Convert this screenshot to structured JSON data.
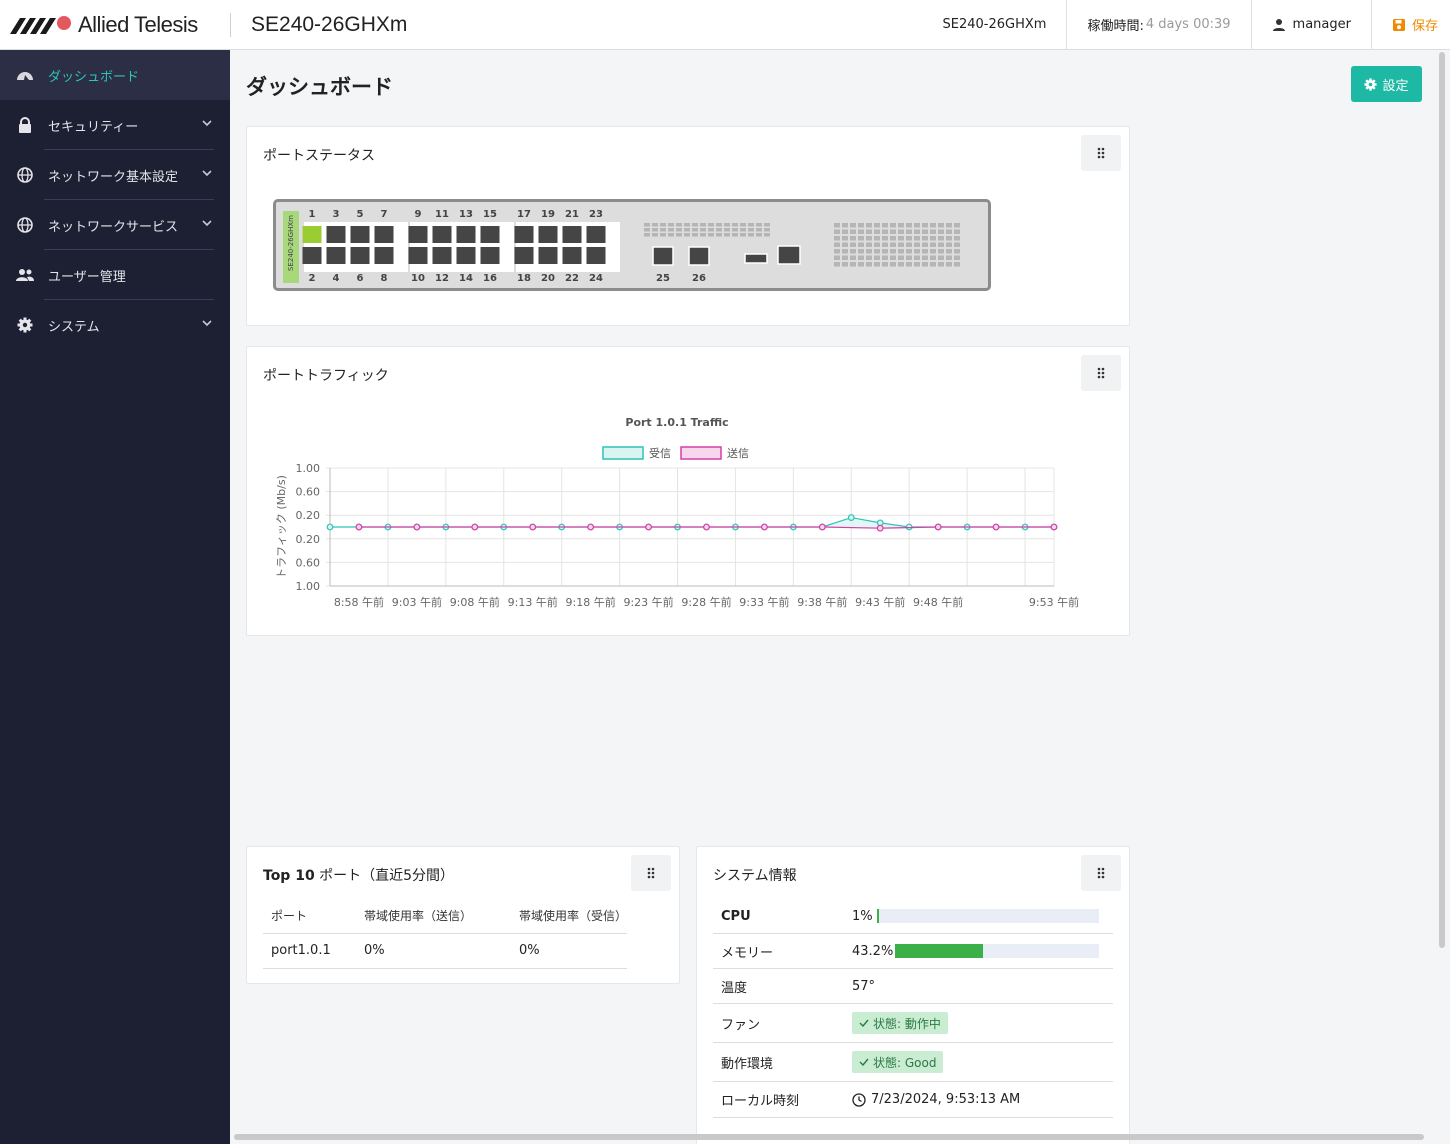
{
  "header": {
    "brand": "Allied Telesis",
    "device_title": "SE240-26GHXm",
    "hostname": "SE240-26GHXm",
    "uptime_label": "稼働時間:",
    "uptime_value": "4 days 00:39",
    "user": "manager",
    "save_label": "保存",
    "icons": [
      "allied-telesis-logo",
      "user-icon",
      "save-icon"
    ],
    "colors": {
      "save": "#f08a00"
    }
  },
  "sidebar": {
    "items": [
      {
        "label": "ダッシュボード",
        "icon": "dashboard-icon",
        "active": true
      },
      {
        "label": "セキュリティー",
        "icon": "lock-icon",
        "expandable": true
      },
      {
        "label": "ネットワーク基本設定",
        "icon": "globe-icon",
        "expandable": true
      },
      {
        "label": "ネットワークサービス",
        "icon": "globe-icon",
        "expandable": true
      },
      {
        "label": "ユーザー管理",
        "icon": "users-icon"
      },
      {
        "label": "システム",
        "icon": "gear-icon",
        "expandable": true
      }
    ],
    "colors": {
      "background": "#1d1f33",
      "active_text": "#2ec4b6"
    }
  },
  "page": {
    "title": "ダッシュボード",
    "settings_label": "設定"
  },
  "port_status": {
    "title": "ポートステータス",
    "device_label": "SE240-26GHXm",
    "top_numbers": [
      "1",
      "3",
      "5",
      "7",
      "9",
      "11",
      "13",
      "15",
      "17",
      "19",
      "21",
      "23"
    ],
    "bottom_numbers": [
      "2",
      "4",
      "6",
      "8",
      "10",
      "12",
      "14",
      "16",
      "18",
      "20",
      "22",
      "24"
    ],
    "sfp_numbers": [
      "25",
      "26"
    ],
    "active_ports": [
      "1"
    ],
    "colors": {
      "port_up": "#9acd32",
      "port_down": "#454545"
    }
  },
  "port_traffic": {
    "title": "ポートトラフィック"
  },
  "chart_data": {
    "type": "line",
    "title": "Port 1.0.1 Traffic",
    "ylabel": "トラフィック (Mb/s)",
    "xlabel": "",
    "x_ticks": [
      "8:58 午前",
      "9:03 午前",
      "9:08 午前",
      "9:13 午前",
      "9:18 午前",
      "9:23 午前",
      "9:28 午前",
      "9:33 午前",
      "9:38 午前",
      "9:43 午前",
      "9:48 午前",
      "9:53 午前"
    ],
    "y_ticks": [
      "1.00",
      "0.60",
      "0.20",
      "0.20",
      "0.60",
      "1.00"
    ],
    "ylim": [
      -1.0,
      1.0
    ],
    "series": [
      {
        "name": "受信",
        "color": "#2ec4b6",
        "fill": "#d9f5f2",
        "points": [
          [
            0,
            0
          ],
          [
            1,
            0
          ],
          [
            2,
            0
          ],
          [
            3,
            0
          ],
          [
            4,
            0
          ],
          [
            5,
            0
          ],
          [
            6,
            0
          ],
          [
            7,
            0
          ],
          [
            8,
            0
          ],
          [
            9,
            0
          ],
          [
            10,
            0
          ],
          [
            11,
            0
          ],
          [
            12,
            0
          ],
          [
            13,
            0
          ],
          [
            14,
            0
          ],
          [
            15,
            0
          ],
          [
            16,
            0
          ],
          [
            17,
            0
          ],
          [
            18,
            0.16
          ],
          [
            19,
            0.07
          ],
          [
            20,
            0
          ],
          [
            21,
            0
          ],
          [
            22,
            0
          ],
          [
            23,
            0
          ],
          [
            24,
            0
          ],
          [
            25,
            0
          ]
        ]
      },
      {
        "name": "送信",
        "color": "#d63fa8",
        "fill": "#f7d6ee",
        "points": [
          [
            1,
            0
          ],
          [
            3,
            0
          ],
          [
            5,
            0
          ],
          [
            7,
            0
          ],
          [
            9,
            0
          ],
          [
            11,
            0
          ],
          [
            13,
            0
          ],
          [
            15,
            0
          ],
          [
            17,
            0
          ],
          [
            19,
            -0.02
          ],
          [
            21,
            0
          ],
          [
            23,
            0
          ],
          [
            25,
            0
          ]
        ]
      }
    ],
    "x_min": 0,
    "x_max": 25,
    "grid": true,
    "legend": "top"
  },
  "top10": {
    "title_bold": "Top 10",
    "title_rest": " ポート（直近5分間）",
    "headers": [
      "ポート",
      "帯域使用率（送信）",
      "帯域使用率（受信）"
    ],
    "rows": [
      [
        "port1.0.1",
        "0%",
        "0%"
      ]
    ]
  },
  "system_info": {
    "title": "システム情報",
    "cpu": {
      "label": "CPU",
      "value": "1%",
      "fraction": 0.01
    },
    "memory": {
      "label": "メモリー",
      "value": "43.2%",
      "fraction": 0.432
    },
    "temperature": {
      "label": "温度",
      "value": "57°"
    },
    "fan": {
      "label": "ファン",
      "value": "状態: 動作中"
    },
    "environment": {
      "label": "動作環境",
      "value": "状態: Good"
    },
    "local_time": {
      "label": "ローカル時刻",
      "value": "7/23/2024, 9:53:13 AM",
      "icon": "clock-icon"
    },
    "colors": {
      "bar": "#3cb048",
      "bar_track": "#e9eef6",
      "badge_bg": "#c9ecd2",
      "badge_text": "#2d7a44"
    }
  }
}
